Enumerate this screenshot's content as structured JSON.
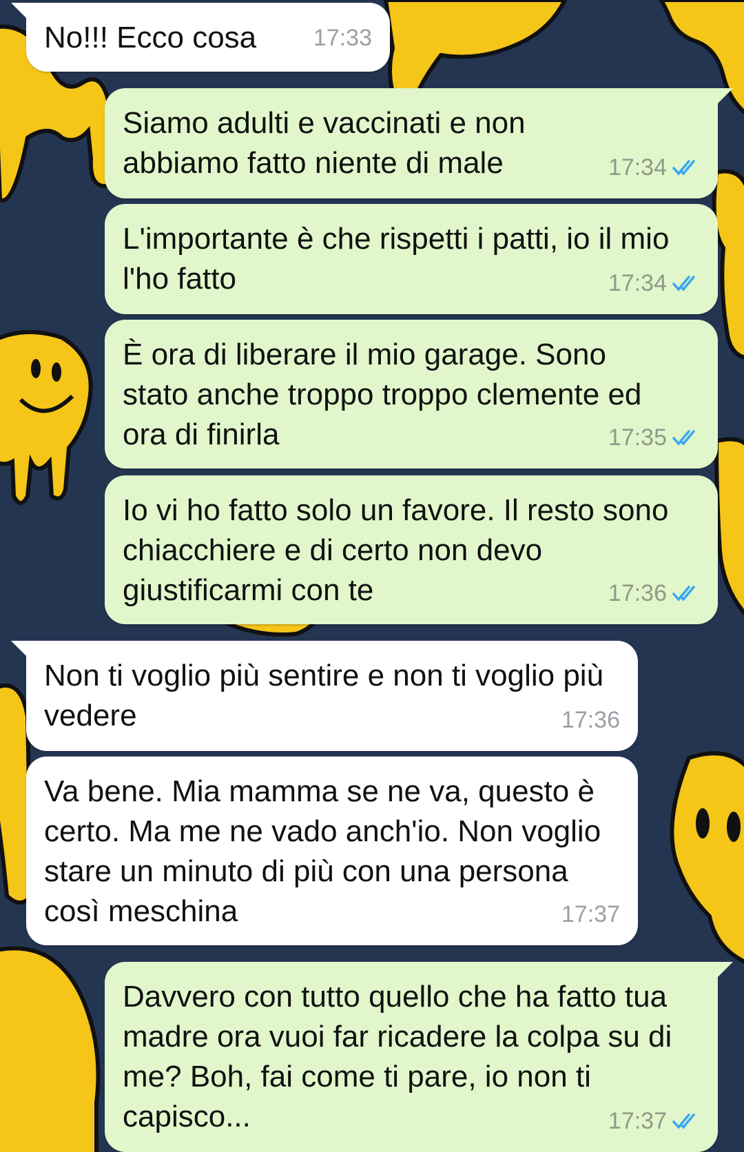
{
  "colors": {
    "wallpaper_bg": "#243552",
    "smiley_yellow": "#f5c518",
    "incoming_bubble": "#ffffff",
    "outgoing_bubble": "#e1f7cb",
    "read_ticks": "#3aa6f0"
  },
  "messages": [
    {
      "direction": "incoming",
      "text": "No!!! Ecco cosa",
      "time": "17:33",
      "ticks": ""
    },
    {
      "direction": "outgoing",
      "text": "Siamo adulti e vaccinati e non abbiamo fatto niente di male",
      "time": "17:34",
      "ticks": "read-double-check-icon"
    },
    {
      "direction": "outgoing",
      "text": "L'importante è che rispetti i patti, io il mio l'ho fatto",
      "time": "17:34",
      "ticks": "read-double-check-icon"
    },
    {
      "direction": "outgoing",
      "text": "È ora di liberare il mio garage. Sono stato anche troppo troppo clemente ed ora di finirla",
      "time": "17:35",
      "ticks": "read-double-check-icon"
    },
    {
      "direction": "outgoing",
      "text": "Io vi ho fatto solo un favore. Il resto sono chiacchiere e di certo non devo giustificarmi con te",
      "time": "17:36",
      "ticks": "read-double-check-icon"
    },
    {
      "direction": "incoming",
      "text": "Non ti voglio più sentire e non ti voglio più vedere",
      "time": "17:36",
      "ticks": ""
    },
    {
      "direction": "incoming",
      "text": "Va bene. Mia mamma se ne va, questo è certo. Ma me ne vado anch'io. Non voglio stare un minuto di più con una persona così meschina",
      "time": "17:37",
      "ticks": ""
    },
    {
      "direction": "outgoing",
      "text": "Davvero con tutto quello che ha fatto tua madre ora vuoi far ricadere la colpa su di me? Boh, fai come ti pare, io non ti capisco...",
      "time": "17:37",
      "ticks": "read-double-check-icon"
    }
  ]
}
